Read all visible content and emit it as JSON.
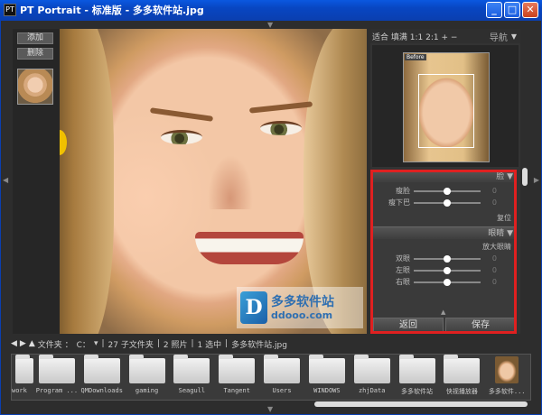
{
  "window": {
    "title": "PT Portrait - 标准版 - 多多软件站.jpg",
    "app_icon": "PT",
    "minimize": "_",
    "maximize": "□",
    "close": "✕"
  },
  "left_panel": {
    "add_label": "添加",
    "remove_label": "删除"
  },
  "watermark": {
    "logo": "D",
    "name": "多多软件站",
    "domain": "ddooo.com"
  },
  "navigator": {
    "zoom_fit": "适合",
    "zoom_fill": "填满",
    "zoom_ratios": "1:1 2:1",
    "zoom_in": "+",
    "zoom_out": "−",
    "title": "导航",
    "before_label": "Before"
  },
  "controls": {
    "face_section": "脸",
    "sliders_face": [
      {
        "label": "瘦脸",
        "level": 0.5,
        "end": "0"
      },
      {
        "label": "瘦下巴",
        "level": 0.5,
        "end": "0"
      }
    ],
    "reset_label": "复位",
    "eyes_section": "眼睛",
    "enlarge_label": "放大眼睛",
    "sliders_eyes": [
      {
        "label": "双眼",
        "level": 0.5,
        "end": "0"
      },
      {
        "label": "左眼",
        "level": 0.5,
        "end": "0"
      },
      {
        "label": "右眼",
        "level": 0.5,
        "end": "0"
      }
    ],
    "back_button": "返回",
    "save_button": "保存"
  },
  "pathbar": {
    "folder_label": "文件夹 ：",
    "drive": "C：",
    "subfolders": "27 子文件夹",
    "photos": "2 照片",
    "selected": "1 选中",
    "current_file": "多多软件站.jpg"
  },
  "folders": [
    {
      "label": "work",
      "type": "folder"
    },
    {
      "label": "Program ...",
      "type": "folder"
    },
    {
      "label": "QMDownloads",
      "type": "folder"
    },
    {
      "label": "gaming",
      "type": "folder"
    },
    {
      "label": "Seagull",
      "type": "folder"
    },
    {
      "label": "Tangent",
      "type": "folder"
    },
    {
      "label": "Users",
      "type": "folder"
    },
    {
      "label": "WINDOWS",
      "type": "folder"
    },
    {
      "label": "zhjData",
      "type": "folder"
    },
    {
      "label": "多多软件站",
      "type": "folder"
    },
    {
      "label": "快视播放器",
      "type": "folder"
    },
    {
      "label": "多多软件...",
      "type": "photo"
    }
  ],
  "colors": {
    "titlebar": "#0a4fd0",
    "highlight": "#e02020",
    "panel": "#333333"
  }
}
